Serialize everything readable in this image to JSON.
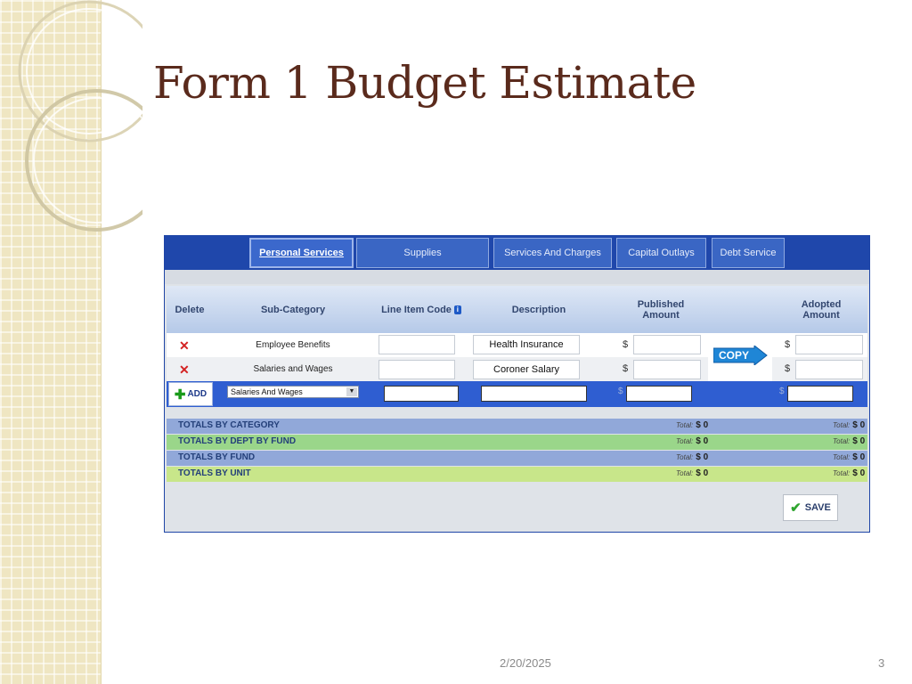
{
  "slide": {
    "title": "Form 1 Budget Estimate",
    "date": "2/20/2025",
    "page_number": "3"
  },
  "tabs": [
    {
      "label": "Personal Services",
      "active": true
    },
    {
      "label": "Supplies",
      "active": false
    },
    {
      "label": "Services And Charges",
      "active": false
    },
    {
      "label": "Capital Outlays",
      "active": false
    },
    {
      "label": "Debt Service",
      "active": false
    }
  ],
  "table": {
    "headers": {
      "delete": "Delete",
      "sub_category": "Sub-Category",
      "line_item_code": "Line Item Code",
      "description": "Description",
      "published_amount": "Published Amount",
      "adopted_amount": "Adopted Amount"
    },
    "rows": [
      {
        "sub_category": "Employee Benefits",
        "line_item_code": "",
        "description": "Health Insurance",
        "published_amount": "",
        "adopted_amount": ""
      },
      {
        "sub_category": "Salaries and Wages",
        "line_item_code": "",
        "description": "Coroner Salary",
        "published_amount": "",
        "adopted_amount": ""
      }
    ],
    "currency_symbol": "$",
    "delete_glyph": "✕",
    "copy_label": "COPY"
  },
  "add_row": {
    "add_label": "ADD",
    "subcategory_selected": "Salaries And Wages",
    "line_item_code": "",
    "description": "",
    "published_amount": "",
    "adopted_amount": ""
  },
  "totals": [
    {
      "label": "TOTALS  BY CATEGORY",
      "published_prefix": "Total:",
      "published_value": "$ 0",
      "adopted_prefix": "Total:",
      "adopted_value": "$ 0",
      "color": "#91a8d9"
    },
    {
      "label": "TOTALS  BY DEPT BY FUND",
      "published_prefix": "Total:",
      "published_value": "$ 0",
      "adopted_prefix": "Total:",
      "adopted_value": "$ 0",
      "color": "#9ad68a"
    },
    {
      "label": "TOTALS  BY FUND",
      "published_prefix": "Total:",
      "published_value": "$ 0",
      "adopted_prefix": "Total:",
      "adopted_value": "$ 0",
      "color": "#91a8d9"
    },
    {
      "label": "TOTALS  BY UNIT",
      "published_prefix": "Total:",
      "published_value": "$ 0",
      "adopted_prefix": "Total:",
      "adopted_value": "$ 0",
      "color": "#c8e68a"
    }
  ],
  "save_label": "SAVE",
  "icons": {
    "delete": "close-icon",
    "add": "plus-icon",
    "copy": "arrow-right-icon",
    "save": "checkmark-icon",
    "info": "info-icon",
    "dropdown": "chevron-down-icon"
  },
  "colors": {
    "title": "#5a2a1c",
    "tab_bar": "#1f47ab",
    "add_row": "#2f5ed1",
    "delete": "#d32222",
    "copy_button": "#1f86d6"
  }
}
